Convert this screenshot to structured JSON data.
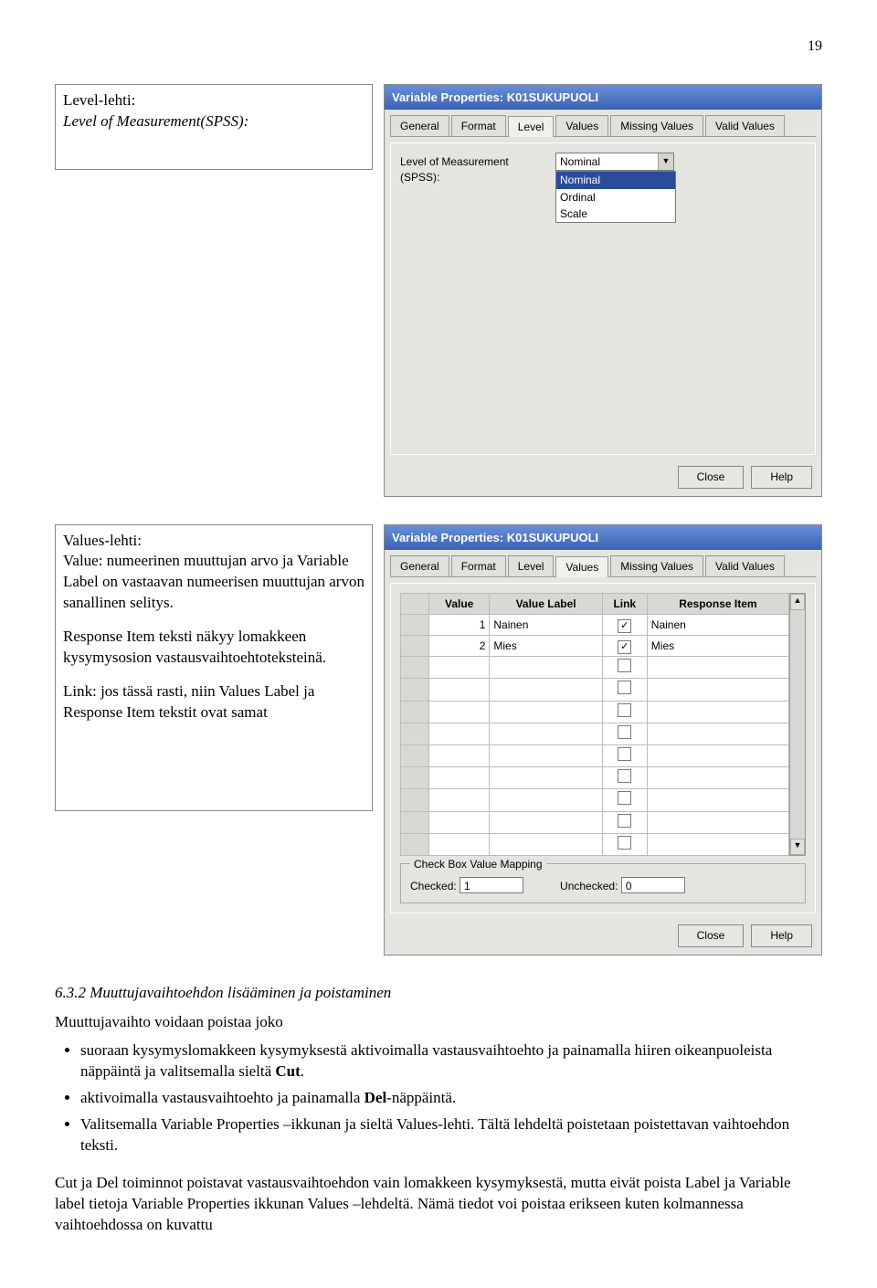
{
  "page_number": "19",
  "row1": {
    "heading": "Level-lehti:",
    "desc": "Level of Measurement(SPSS):"
  },
  "row2": {
    "heading": "Values-lehti:",
    "p1": "Value: numeerinen muuttujan arvo ja Variable Label on vastaavan numeerisen muuttujan arvon sanallinen selitys.",
    "p2": "Response Item teksti näkyy lomakkeen kysymysosion vastausvaihtoehtoteksteinä.",
    "p3": "Link: jos tässä rasti, niin Values Label ja Response Item tekstit ovat samat"
  },
  "dlg1": {
    "title": "Variable Properties: K01SUKUPUOLI",
    "tabs": [
      "General",
      "Format",
      "Level",
      "Values",
      "Missing Values",
      "Valid Values"
    ],
    "active_tab": 2,
    "field_label": "Level of Measurement (SPSS):",
    "dropdown_value": "Nominal",
    "options": [
      "Nominal",
      "Ordinal",
      "Scale"
    ],
    "close": "Close",
    "help": "Help"
  },
  "dlg2": {
    "title": "Variable Properties: K01SUKUPUOLI",
    "tabs": [
      "General",
      "Format",
      "Level",
      "Values",
      "Missing Values",
      "Valid Values"
    ],
    "active_tab": 3,
    "columns": [
      "Value",
      "Value Label",
      "Link",
      "Response Item"
    ],
    "rows": [
      {
        "value": "1",
        "label": "Nainen",
        "link": true,
        "response": "Nainen"
      },
      {
        "value": "2",
        "label": "Mies",
        "link": true,
        "response": "Mies"
      }
    ],
    "empty_rows": 9,
    "fieldset_title": "Check Box Value Mapping",
    "checked_label": "Checked:",
    "checked_value": "1",
    "unchecked_label": "Unchecked:",
    "unchecked_value": "0",
    "close": "Close",
    "help": "Help"
  },
  "section_title": "6.3.2 Muuttujavaihtoehdon lisääminen ja poistaminen",
  "section_lead": "Muuttujavaihto voidaan poistaa joko",
  "bullets": [
    "suoraan kysymyslomakkeen kysymyksestä aktivoimalla vastausvaihtoehto ja painamalla hiiren oikeanpuoleista näppäintä  ja valitsemalla sieltä Cut.",
    "aktivoimalla vastausvaihtoehto ja painamalla Del-näppäintä.",
    "Valitsemalla Variable Properties –ikkunan ja sieltä Values-lehti. Tältä lehdeltä poistetaan poistettavan vaihtoehdon teksti."
  ],
  "bottom_para": "Cut ja Del toiminnot poistavat vastausvaihtoehdon vain lomakkeen kysymyksestä, mutta eivät poista Label ja Variable label tietoja Variable Properties ikkunan Values –lehdeltä. Nämä tiedot voi poistaa erikseen kuten kolmannessa vaihtoehdossa on kuvattu"
}
